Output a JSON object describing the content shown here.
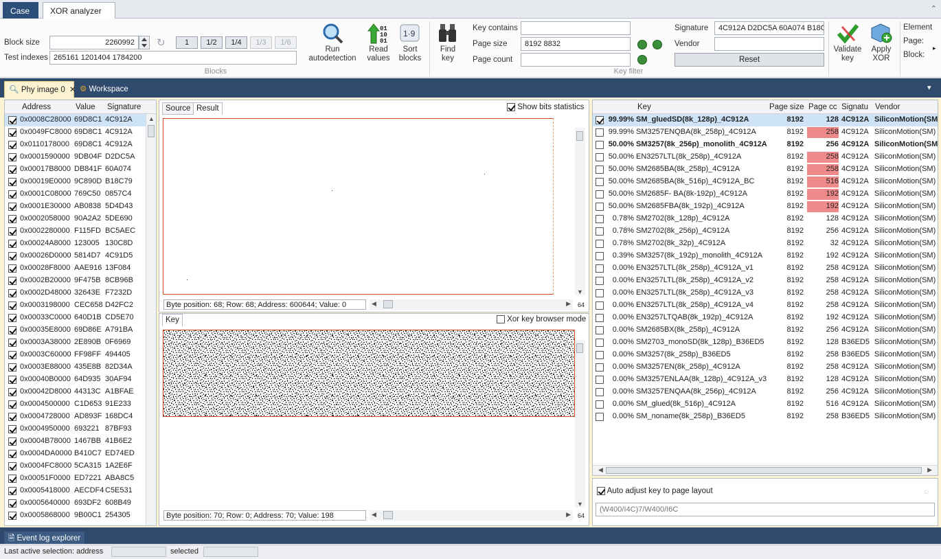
{
  "app_tabs": [
    "Case",
    "XOR analyzer"
  ],
  "ribbon": {
    "block_size_label": "Block size",
    "block_size_value": "2260992",
    "test_indexes_label": "Test indexes",
    "test_indexes_value": "265161 1201404 1784200",
    "fractions": [
      "1",
      "1/2",
      "1/4",
      "1/3",
      "1/6"
    ],
    "blocks_group": "Blocks",
    "run_autodetection": [
      "Run",
      "autodetection"
    ],
    "read_values": [
      "Read",
      "values"
    ],
    "sort_blocks": [
      "Sort",
      "blocks"
    ],
    "find_key": [
      "Find",
      "key"
    ],
    "key_contains_label": "Key  contains",
    "key_contains_value": "",
    "page_size_label": "Page size",
    "page_size_value": "8192 8832",
    "page_count_label": "Page count",
    "page_count_value": "",
    "key_filter_group": "Key filter",
    "signature_label": "Signature",
    "signature_value": "4C912A D2DC5A 60A074 B18C",
    "vendor_label": "Vendor",
    "vendor_value": "",
    "reset_label": "Reset",
    "validate_key": [
      "Validate",
      "key"
    ],
    "apply_xor": [
      "Apply",
      "XOR"
    ],
    "element_label": "Element",
    "page_label": "Page:",
    "block_label": "Block:"
  },
  "panel_tabs": {
    "phy": "Phy image 0",
    "workspace": "Workspace"
  },
  "address_table": {
    "headers": [
      "Address",
      "Value",
      "Signature"
    ],
    "rows": [
      [
        "0x0008C28000",
        "69D8C1",
        "4C912A"
      ],
      [
        "0x0049FC8000",
        "69D8C1",
        "4C912A"
      ],
      [
        "0x0110178000",
        "69D8C1",
        "4C912A"
      ],
      [
        "0x0001590000",
        "9DB04F",
        "D2DC5A"
      ],
      [
        "0x00017B8000",
        "DB841F",
        "60A074"
      ],
      [
        "0x00019E0000",
        "9C890D",
        "B18C79"
      ],
      [
        "0x0001C08000",
        "769C50",
        "0857C4"
      ],
      [
        "0x0001E30000",
        "AB0838",
        "5D4D43"
      ],
      [
        "0x0002058000",
        "90A2A2",
        "5DE690"
      ],
      [
        "0x0002280000",
        "F115FD",
        "BC5AEC"
      ],
      [
        "0x00024A8000",
        "123005",
        "130C8D"
      ],
      [
        "0x00026D0000",
        "5814D7",
        "4C91D5"
      ],
      [
        "0x00028F8000",
        "AAE916",
        "13F084"
      ],
      [
        "0x0002B20000",
        "9F475B",
        "8CB96B"
      ],
      [
        "0x0002D48000",
        "32643E",
        "F7232D"
      ],
      [
        "0x0003198000",
        "CEC658",
        "D42FC2"
      ],
      [
        "0x00033C0000",
        "640D1B",
        "CD5E70"
      ],
      [
        "0x00035E8000",
        "69D86E",
        "A791BA"
      ],
      [
        "0x0003A38000",
        "2E890B",
        "0F6969"
      ],
      [
        "0x0003C60000",
        "FF98FF",
        "494405"
      ],
      [
        "0x0003E88000",
        "435E8B",
        "82D34A"
      ],
      [
        "0x00040B0000",
        "64D935",
        "30AF94"
      ],
      [
        "0x00042D8000",
        "44313C",
        "A1BFAE"
      ],
      [
        "0x0004500000",
        "C1D653",
        "91E233"
      ],
      [
        "0x0004728000",
        "AD893F",
        "168DC4"
      ],
      [
        "0x0004950000",
        "693221",
        "87BF93"
      ],
      [
        "0x0004B78000",
        "1467BB",
        "41B6E2"
      ],
      [
        "0x0004DA0000",
        "B410C7",
        "ED74ED"
      ],
      [
        "0x0004FC8000",
        "5CA315",
        "1A2E6F"
      ],
      [
        "0x00051F0000",
        "ED7221",
        "ABA8C5"
      ],
      [
        "0x0005418000",
        "AECDF4",
        "C5E531"
      ],
      [
        "0x0005640000",
        "693DF2",
        "608B49"
      ],
      [
        "0x0005868000",
        "9B00C1",
        "254305"
      ]
    ]
  },
  "result_panel": {
    "tab_source": "Source",
    "tab_result": "Result",
    "show_bits": "Show bits statistics",
    "status": "Byte position: 68; Row: 68; Address: 600644; Value: 0",
    "width": "64"
  },
  "key_panel": {
    "tab_key": "Key",
    "xor_browser": "Xor key browser mode",
    "status": "Byte position: 70; Row: 0; Address: 70; Value: 198",
    "width": "64"
  },
  "keys_table": {
    "headers": [
      "Key",
      "Page size",
      "Page cc",
      "Signatu",
      "Vendor"
    ],
    "rows": [
      {
        "pct": "99.99%",
        "key": "SM_gluedSD(8k_128p)_4C912A",
        "ps": "8192",
        "pc": "128",
        "sig": "4C912A",
        "vendor": "SiliconMotion(SM",
        "checked": true,
        "bold": true,
        "sel": true,
        "bar": 0
      },
      {
        "pct": "99.99%",
        "key": "SM3257ENQBA(8k_258p)_4C912A",
        "ps": "8192",
        "pc": "258",
        "sig": "4C912A",
        "vendor": "SiliconMotion(SM)",
        "bar": 1
      },
      {
        "pct": "50.00%",
        "key": "SM3257(8k_256p)_monolith_4C912A",
        "ps": "8192",
        "pc": "256",
        "sig": "4C912A",
        "vendor": "SiliconMotion(SM",
        "bold": true,
        "bar": 0
      },
      {
        "pct": "50.00%",
        "key": "EN3257LTL(8k_258p)_4C912A",
        "ps": "8192",
        "pc": "258",
        "sig": "4C912A",
        "vendor": "SiliconMotion(SM)",
        "bar": 1
      },
      {
        "pct": "50.00%",
        "key": "SM2685BA(8k_258p)_4C912A",
        "ps": "8192",
        "pc": "258",
        "sig": "4C912A",
        "vendor": "SiliconMotion(SM)",
        "bar": 1
      },
      {
        "pct": "50.00%",
        "key": "SM2685BA(8k_516p)_4C912A_BC",
        "ps": "8192",
        "pc": "516",
        "sig": "4C912A",
        "vendor": "SiliconMotion(SM)",
        "bar": 1
      },
      {
        "pct": "50.00%",
        "key": "SM2685F- BA(8k-192p)_4C912A",
        "ps": "8192",
        "pc": "192",
        "sig": "4C912A",
        "vendor": "SiliconMotion(SM)",
        "bar": 1
      },
      {
        "pct": "50.00%",
        "key": "SM2685FBA(8k_192p)_4C912A",
        "ps": "8192",
        "pc": "192",
        "sig": "4C912A",
        "vendor": "SiliconMotion(SM)",
        "bar": 1
      },
      {
        "pct": "0.78%",
        "key": "SM2702(8k_128p)_4C912A",
        "ps": "8192",
        "pc": "128",
        "sig": "4C912A",
        "vendor": "SiliconMotion(SM)",
        "bar": 0
      },
      {
        "pct": "0.78%",
        "key": "SM2702(8k_256p)_4C912A",
        "ps": "8192",
        "pc": "256",
        "sig": "4C912A",
        "vendor": "SiliconMotion(SM)",
        "bar": 0
      },
      {
        "pct": "0.78%",
        "key": "SM2702(8k_32p)_4C912A",
        "ps": "8192",
        "pc": "32",
        "sig": "4C912A",
        "vendor": "SiliconMotion(SM)",
        "bar": 0
      },
      {
        "pct": "0.39%",
        "key": "SM3257(8k_192p)_monolith_4C912A",
        "ps": "8192",
        "pc": "192",
        "sig": "4C912A",
        "vendor": "SiliconMotion(SM)",
        "bar": 0
      },
      {
        "pct": "0.00%",
        "key": "EN3257LTL(8k_258p)_4C912A_v1",
        "ps": "8192",
        "pc": "258",
        "sig": "4C912A",
        "vendor": "SiliconMotion(SM)",
        "bar": 0
      },
      {
        "pct": "0.00%",
        "key": "EN3257LTL(8k_258p)_4C912A_v2",
        "ps": "8192",
        "pc": "258",
        "sig": "4C912A",
        "vendor": "SiliconMotion(SM)",
        "bar": 0
      },
      {
        "pct": "0.00%",
        "key": "EN3257LTL(8k_258p)_4C912A_v3",
        "ps": "8192",
        "pc": "258",
        "sig": "4C912A",
        "vendor": "SiliconMotion(SM)",
        "bar": 0
      },
      {
        "pct": "0.00%",
        "key": "EN3257LTL(8k_258p)_4C912A_v4",
        "ps": "8192",
        "pc": "258",
        "sig": "4C912A",
        "vendor": "SiliconMotion(SM)",
        "bar": 0
      },
      {
        "pct": "0.00%",
        "key": "EN3257LTQAB(8k_192p)_4C912A",
        "ps": "8192",
        "pc": "192",
        "sig": "4C912A",
        "vendor": "SiliconMotion(SM)",
        "bar": 0
      },
      {
        "pct": "0.00%",
        "key": "SM2685BX(8k_258p)_4C912A",
        "ps": "8192",
        "pc": "256",
        "sig": "4C912A",
        "vendor": "SiliconMotion(SM)",
        "bar": 0
      },
      {
        "pct": "0.00%",
        "key": "SM2703_monoSD(8k_128p)_B36ED5",
        "ps": "8192",
        "pc": "128",
        "sig": "B36ED5",
        "vendor": "SiliconMotion(SM)",
        "bar": 0
      },
      {
        "pct": "0.00%",
        "key": "SM3257(8k_258p)_B36ED5",
        "ps": "8192",
        "pc": "258",
        "sig": "B36ED5",
        "vendor": "SiliconMotion(SM)",
        "bar": 0
      },
      {
        "pct": "0.00%",
        "key": "SM3257EN(8k_258p)_4C912A",
        "ps": "8192",
        "pc": "258",
        "sig": "4C912A",
        "vendor": "SiliconMotion(SM)",
        "bar": 0
      },
      {
        "pct": "0.00%",
        "key": "SM3257ENLAA(8k_128p)_4C912A_v3",
        "ps": "8192",
        "pc": "128",
        "sig": "4C912A",
        "vendor": "SiliconMotion(SM)",
        "bar": 0
      },
      {
        "pct": "0.00%",
        "key": "SM3257ENQAA(8k_256p)_4C912A",
        "ps": "8192",
        "pc": "256",
        "sig": "4C912A",
        "vendor": "SiliconMotion(SM)",
        "bar": 0
      },
      {
        "pct": "0.00%",
        "key": "SM_glued(8k_516p)_4C912A",
        "ps": "8192",
        "pc": "516",
        "sig": "4C912A",
        "vendor": "SiliconMotion(SM)",
        "bar": 0
      },
      {
        "pct": "0.00%",
        "key": "SM_noname(8k_258p)_B36ED5",
        "ps": "8192",
        "pc": "258",
        "sig": "B36ED5",
        "vendor": "SiliconMotion(SM)",
        "bar": 0
      }
    ]
  },
  "auto_adjust": {
    "label": "Auto adjust key to page layout",
    "pattern": "(W400/I4C)7/W400/I6C"
  },
  "event_log": "Event log explorer",
  "statusbar": {
    "last_active": "Last active selection:  address",
    "selected": "selected"
  },
  "colors": {
    "accent_dark": "#2f4a6c",
    "highlight_pink": "#f08a8a",
    "selected_row": "#cfe3f7",
    "panel_bg": "#fbf3d2"
  }
}
